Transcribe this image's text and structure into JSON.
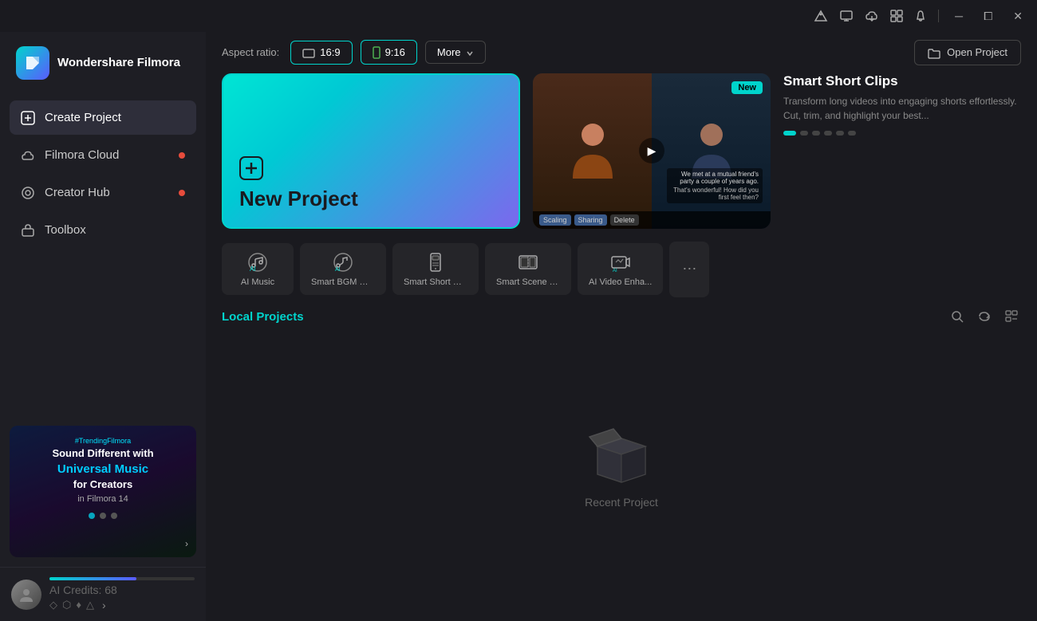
{
  "app": {
    "name": "Wondershare Filmora"
  },
  "titlebar": {
    "icons": [
      "signal-icon",
      "monitor-icon",
      "cloud-icon",
      "grid-icon",
      "bell-icon"
    ],
    "minimize_label": "─",
    "maximize_label": "⧠",
    "close_label": "✕"
  },
  "sidebar": {
    "logo_text": "Wondershare\nFilmora",
    "nav_items": [
      {
        "id": "create-project",
        "label": "Create Project",
        "active": true,
        "dot": false
      },
      {
        "id": "filmora-cloud",
        "label": "Filmora Cloud",
        "active": false,
        "dot": true
      },
      {
        "id": "creator-hub",
        "label": "Creator Hub",
        "active": false,
        "dot": true
      },
      {
        "id": "toolbox",
        "label": "Toolbox",
        "active": false,
        "dot": false
      }
    ],
    "ad_hashtag": "#TrendingFilmora",
    "ad_title1": "Sound Different with",
    "ad_title2": "Universal Music",
    "ad_title3": "for Creators",
    "ad_subtitle": "in Filmora 14",
    "user_credits": "AI Credits: 68"
  },
  "topbar": {
    "aspect_label": "Aspect ratio:",
    "aspect_169": "16:9",
    "aspect_916": "9:16",
    "more_label": "More",
    "open_project_label": "Open Project"
  },
  "new_project": {
    "add_icon": "⊕",
    "label": "New Project"
  },
  "featured": {
    "new_badge": "New",
    "title": "Smart Short Clips",
    "description": "Transform long videos into engaging shorts effortlessly. Cut, trim, and highlight your best...",
    "dots": [
      true,
      false,
      false,
      false,
      false,
      false
    ],
    "delete_label": "Delete",
    "bottom_tags": [
      "Scaling",
      "Sharing",
      "Delete"
    ]
  },
  "toolbar": {
    "items": [
      {
        "id": "ai-music",
        "icon": "🎵",
        "label": "AI Music"
      },
      {
        "id": "smart-bgm",
        "icon": "🎸",
        "label": "Smart BGM Ge..."
      },
      {
        "id": "smart-short",
        "icon": "📱",
        "label": "Smart Short Cli..."
      },
      {
        "id": "smart-scene-cut",
        "icon": "🎬",
        "label": "Smart Scene Cut"
      },
      {
        "id": "ai-video-enhance",
        "icon": "✨",
        "label": "AI Video Enha..."
      }
    ],
    "more_icon": "⋯"
  },
  "local_projects": {
    "title": "Local Projects",
    "search_icon": "🔍",
    "refresh_icon": "🔄",
    "view_icon": "⊞",
    "empty_label": "Recent Project"
  }
}
